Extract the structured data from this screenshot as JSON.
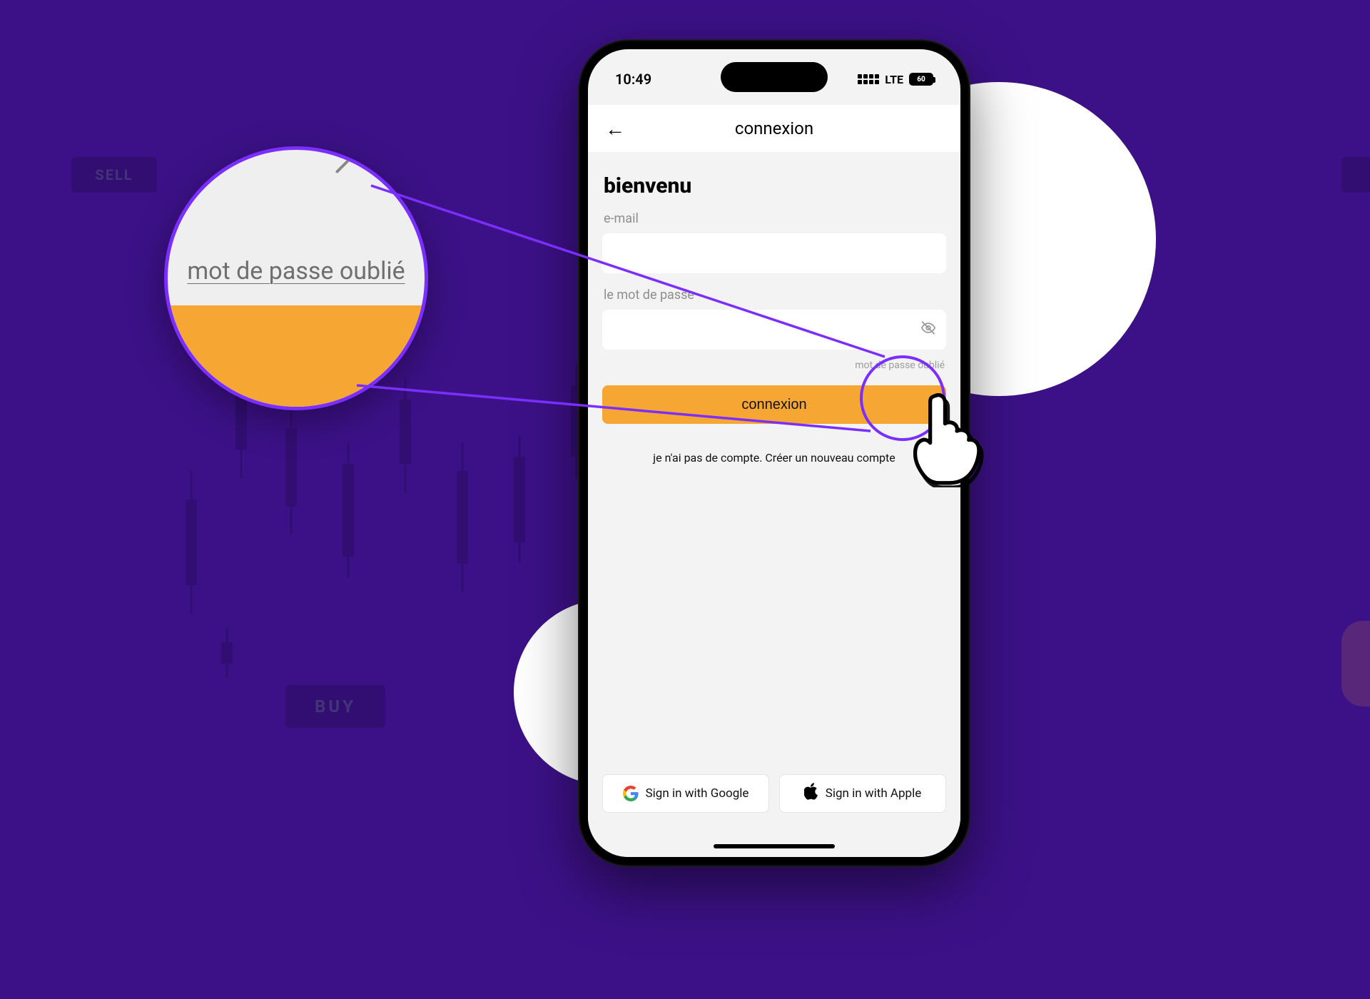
{
  "background": {
    "sell_tag": "SELL",
    "buy_tag": "BUY"
  },
  "status": {
    "time": "10:49",
    "network": "LTE",
    "battery": "60"
  },
  "header": {
    "title": "connexion"
  },
  "login": {
    "welcome": "bienvenu",
    "email_label": "e-mail",
    "password_label": "le mot de passe",
    "forgot_label": "mot de passe oublié",
    "submit_label": "connexion",
    "no_account_text": "je n'ai pas de compte. Créer un nouveau compte"
  },
  "social": {
    "google_label": "Sign in with Google",
    "apple_label": "Sign in with Apple"
  },
  "magnifier": {
    "forgot_text": "mot de passe oublié"
  },
  "colors": {
    "accent_purple": "#7a2eff",
    "action_orange": "#f6a733",
    "bg_purple": "#3c1187"
  }
}
